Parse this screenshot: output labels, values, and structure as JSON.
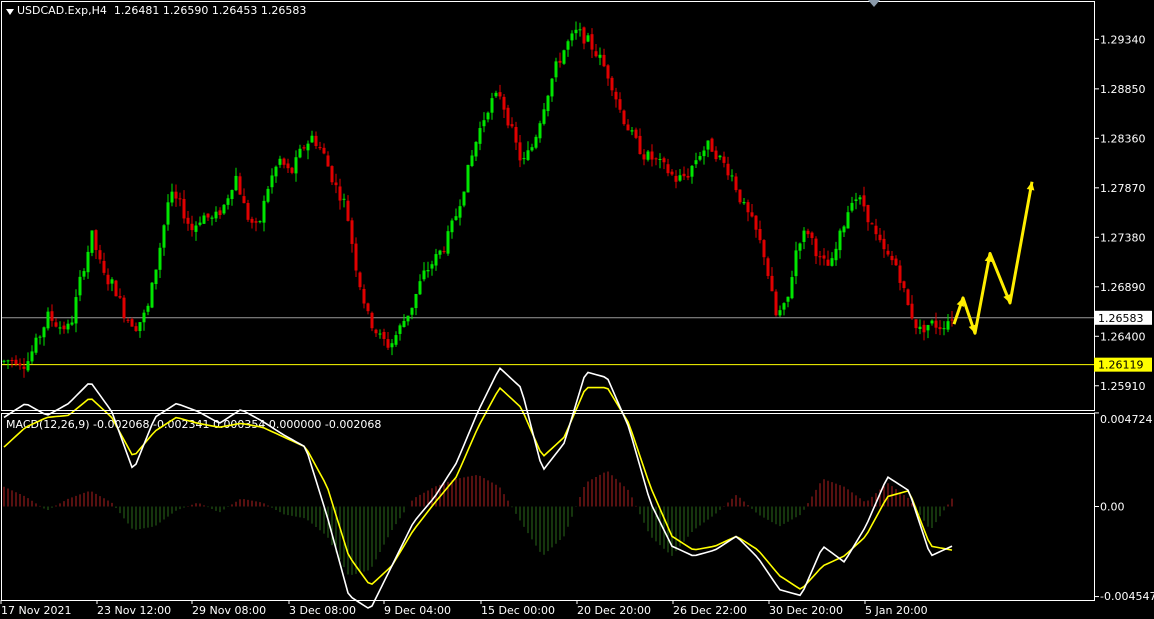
{
  "header": {
    "symbol_line": "USDCAD.Exp,H4  1.26481 1.26590 1.26453 1.26583",
    "macd_line": "MACD(12,26,9) -0.002068 -0.002341 0.000354 0.000000 -0.002068"
  },
  "colors": {
    "background": "#000000",
    "bull": "#00e600",
    "bear": "#e00000",
    "macd_line": "#ffffff",
    "signal_line": "#ffff00",
    "hist_pos": "#b02020",
    "hist_neg": "#2a6a1a",
    "support_line": "#ffff00",
    "price_line": "#9a9a9a",
    "arrows": "#ffee00"
  },
  "chart_data": [
    {
      "type": "candlestick",
      "title": "USDCAD.Exp,H4",
      "ylim": [
        1.2567,
        1.2972
      ],
      "y_ticks": [
        "1.29340",
        "1.28850",
        "1.28360",
        "1.27870",
        "1.27380",
        "1.26890",
        "1.26400",
        "1.25910"
      ],
      "x_ticks": [
        "17 Nov 2021",
        "23 Nov 12:00",
        "29 Nov 08:00",
        "3 Dec 08:00",
        "9 Dec 04:00",
        "15 Dec 00:00",
        "20 Dec 20:00",
        "26 Dec 22:00",
        "30 Dec 20:00",
        "5 Jan 20:00"
      ],
      "last_price": "1.26583",
      "support_level": "1.26119",
      "close_path": [
        1.2615,
        1.2618,
        1.2612,
        1.2635,
        1.266,
        1.265,
        1.2648,
        1.27,
        1.274,
        1.27,
        1.269,
        1.266,
        1.265,
        1.2665,
        1.272,
        1.278,
        1.277,
        1.2745,
        1.276,
        1.2755,
        1.277,
        1.28,
        1.276,
        1.2745,
        1.279,
        1.2815,
        1.28,
        1.2825,
        1.2838,
        1.282,
        1.279,
        1.277,
        1.2705,
        1.266,
        1.264,
        1.263,
        1.265,
        1.267,
        1.27,
        1.2715,
        1.273,
        1.276,
        1.28,
        1.284,
        1.287,
        1.288,
        1.2845,
        1.281,
        1.283,
        1.287,
        1.2905,
        1.2928,
        1.2942,
        1.2932,
        1.2916,
        1.2895,
        1.286,
        1.2838,
        1.282,
        1.2815,
        1.2806,
        1.2795,
        1.28,
        1.282,
        1.283,
        1.2815,
        1.28,
        1.277,
        1.275,
        1.272,
        1.266,
        1.267,
        1.2735,
        1.2745,
        1.2715,
        1.2708,
        1.2745,
        1.278,
        1.277,
        1.274,
        1.272,
        1.271,
        1.267,
        1.2645,
        1.2653,
        1.265,
        1.266
      ]
    },
    {
      "type": "macd",
      "params": "12,26,9",
      "ylim": [
        -0.00472,
        0.00472
      ],
      "y_ticks": [
        "0.004724",
        "0.00",
        "-0.004547"
      ],
      "values": {
        "macd": -0.002068,
        "signal": -0.002341,
        "histogram": 0.000354
      },
      "macd_path": [
        0.0045,
        0.0052,
        0.0046,
        0.0052,
        0.0063,
        0.0048,
        0.0018,
        0.0045,
        0.0052,
        0.0048,
        0.0042,
        0.0049,
        0.0043,
        0.0036,
        0.003,
        -0.0005,
        -0.0045,
        -0.0052,
        -0.003,
        -0.0008,
        0.0005,
        0.0022,
        0.0048,
        0.007,
        0.006,
        0.0018,
        0.0032,
        0.0068,
        0.0065,
        0.004,
        0.0002,
        -0.002,
        -0.0025,
        -0.0022,
        -0.0015,
        -0.0026,
        -0.0042,
        -0.0045,
        -0.002,
        -0.0028,
        -0.001,
        0.0015,
        0.0008,
        -0.0025,
        -0.002
      ],
      "signal_path": [
        0.003,
        0.004,
        0.0045,
        0.0046,
        0.0055,
        0.0045,
        0.0025,
        0.0038,
        0.0045,
        0.0042,
        0.004,
        0.0042,
        0.004,
        0.0035,
        0.003,
        0.001,
        -0.0025,
        -0.004,
        -0.003,
        -0.0012,
        0.0002,
        0.0015,
        0.004,
        0.006,
        0.005,
        0.0025,
        0.0035,
        0.006,
        0.006,
        0.0042,
        0.001,
        -0.0015,
        -0.0022,
        -0.002,
        -0.0015,
        -0.0022,
        -0.0035,
        -0.0042,
        -0.003,
        -0.0025,
        -0.0015,
        0.0005,
        0.0008,
        -0.002,
        -0.0022
      ],
      "hist_path": [
        0.001,
        0.0005,
        -0.0002,
        0.0004,
        0.0008,
        0.0002,
        -0.0012,
        -0.001,
        -0.0002,
        0.0002,
        -0.0003,
        0.0004,
        0.0002,
        -0.0004,
        -0.0006,
        -0.0015,
        -0.0035,
        -0.0032,
        -0.0012,
        0.0004,
        0.001,
        0.0014,
        0.0016,
        0.001,
        -0.0008,
        -0.0025,
        -0.0015,
        0.0012,
        0.0018,
        0.0008,
        -0.0015,
        -0.0025,
        -0.0012,
        -0.0004,
        0.0006,
        -0.0004,
        -0.001,
        -0.0004,
        0.0014,
        0.001,
        0.0002,
        0.0012,
        0.0004,
        -0.0012,
        0.0004
      ]
    }
  ],
  "annotations": {
    "arrows": "yellow forecast zig-zag arrows after the last candle"
  }
}
